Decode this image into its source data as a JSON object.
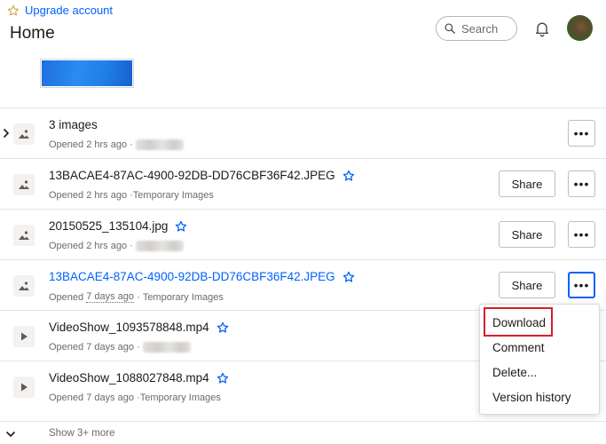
{
  "header": {
    "upgrade_label": "Upgrade account",
    "title": "Home",
    "search_placeholder": "Search"
  },
  "files": [
    {
      "name": "3 images",
      "meta": "Opened 2 hrs ago · ",
      "location": "",
      "expandable": true,
      "share": false,
      "type": "image",
      "starred": false
    },
    {
      "name": "13BACAE4-87AC-4900-92DB-DD76CBF36F42.JPEG",
      "meta": "Opened 2 hrs ago · ",
      "location": "Temporary Images",
      "share": true,
      "type": "image",
      "starred": true
    },
    {
      "name": "20150525_135104.jpg",
      "meta": "Opened 2 hrs ago · ",
      "location": "",
      "share": true,
      "type": "image",
      "starred": true
    },
    {
      "name": "13BACAE4-87AC-4900-92DB-DD76CBF36F42.JPEG",
      "meta_prefix": "Opened ",
      "meta_time": "7 days ago",
      "meta_sep": " · ",
      "location": "Temporary Images",
      "share": true,
      "type": "image",
      "starred": true,
      "active": true
    },
    {
      "name": "VideoShow_1093578848.mp4",
      "meta": "Opened 7 days ago · ",
      "location": "",
      "share": false,
      "type": "video",
      "starred": true
    },
    {
      "name": "VideoShow_1088027848.mp4",
      "meta": "Opened 7 days ago · ",
      "location": "Temporary Images",
      "share": false,
      "type": "video",
      "starred": true
    }
  ],
  "share_label": "Share",
  "more_label": "•••",
  "context_menu": {
    "items": [
      "Download",
      "Comment",
      "Delete...",
      "Version history"
    ],
    "highlighted": "Download"
  },
  "show_more_label": "Show 3+ more",
  "colors": {
    "accent": "#0061fe",
    "highlight": "#d4202a"
  }
}
